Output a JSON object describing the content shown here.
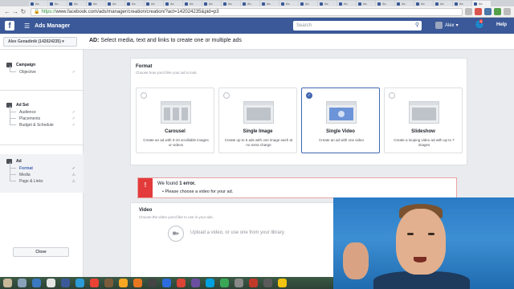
{
  "browser": {
    "tabs": [
      "Ac",
      "Ac",
      "Ac",
      "Ac",
      "Ac",
      "Ac",
      "Ac",
      "Ac",
      "Ac",
      "Ac",
      "Ac",
      "Ac",
      "Ac",
      "Ac",
      "Ac",
      "Ac",
      "Ac",
      "Ac",
      "Ac",
      "Ac",
      "Ac",
      "Ac",
      "Ac",
      "Ac"
    ],
    "url_prefix": "https://",
    "url_rest": "www.facebook.com/ads/manager/creation/creation/?act=142024235&pid=p3"
  },
  "header": {
    "app_name": "Ads Manager",
    "search_placeholder": "Search",
    "user_name": "Alex",
    "notif_count": "9",
    "help_label": "Help"
  },
  "subbar": {
    "account_selector": "Alex Genadinik (142024235) ▾",
    "title_bold": "AD:",
    "title_rest": "Select media, text and links to create one or multiple ads"
  },
  "sidebar": {
    "campaign": {
      "label": "Campaign",
      "steps": [
        {
          "label": "Objective",
          "status": "✓"
        }
      ]
    },
    "adset": {
      "label": "Ad Set",
      "steps": [
        {
          "label": "Audience",
          "status": "✓"
        },
        {
          "label": "Placements",
          "status": "✓"
        },
        {
          "label": "Budget & Schedule",
          "status": "✓"
        }
      ]
    },
    "ad": {
      "label": "Ad",
      "steps": [
        {
          "label": "Format",
          "status": "✓"
        },
        {
          "label": "Media",
          "status": "⚠"
        },
        {
          "label": "Page & Links",
          "status": "⚠"
        }
      ]
    },
    "close_label": "Close"
  },
  "format": {
    "label": "Format",
    "subtitle": "Choose how you'd like your ad to look.",
    "options": [
      {
        "title": "Carousel",
        "desc": "Create an ad with 3-10 scrollable images or videos",
        "selected": false
      },
      {
        "title": "Single Image",
        "desc": "Create up to 6 ads with one image each at no extra charge",
        "selected": false
      },
      {
        "title": "Single Video",
        "desc": "Create an ad with one video",
        "selected": true
      },
      {
        "title": "Slideshow",
        "desc": "Create a looping video ad with up to 7 images",
        "selected": false
      }
    ]
  },
  "error": {
    "icon": "!",
    "title_prefix": "We found",
    "title_bold": "1 error.",
    "message": "Please choose a video for your ad."
  },
  "video": {
    "label": "Video",
    "subtitle": "Choose the video you'd like to use in your ads.",
    "upload_text": "Upload a video, or use one from your library."
  },
  "colors": {
    "fb_blue": "#3b5998",
    "accent": "#4267b2",
    "error_red": "#e33b3b"
  }
}
